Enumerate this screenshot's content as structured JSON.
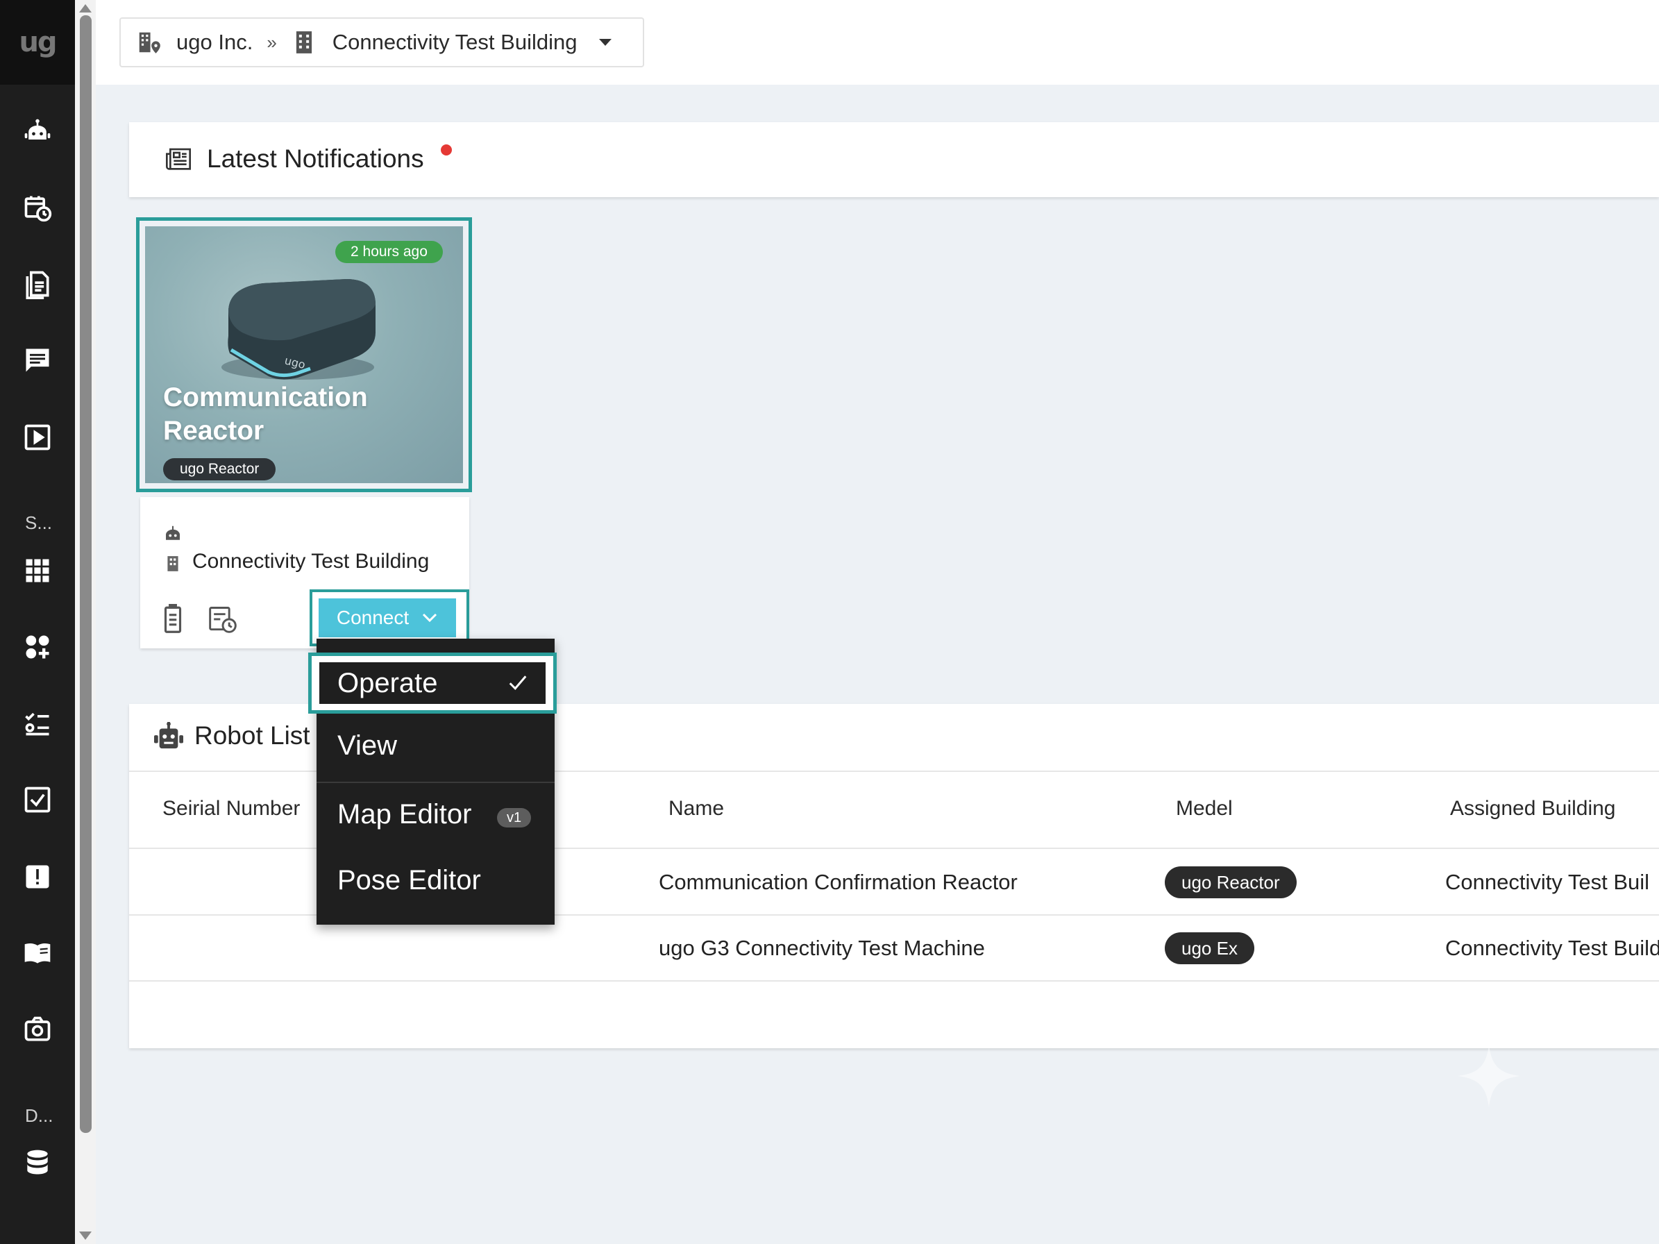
{
  "app": {
    "logo_text": "ug"
  },
  "sidebar": {
    "icons": [
      "robot-icon",
      "calendar-clock-icon",
      "document-icon",
      "chat-icon",
      "play-icon",
      "grid-icon",
      "apps-icon",
      "checklist-icon",
      "checkbox-icon",
      "alert-icon",
      "book-icon",
      "camera-icon",
      "database-icon"
    ],
    "section_labels": [
      "S...",
      "D..."
    ]
  },
  "breadcrumb": {
    "org": "ugo Inc.",
    "separator": "»",
    "building": "Connectivity Test Building"
  },
  "notifications": {
    "title": "Latest Notifications",
    "card": {
      "time": "2 hours ago",
      "title": "Communication Reactor",
      "model": "ugo Reactor",
      "device_label": "ugo",
      "building": "Connectivity Test Building",
      "connect_label": "Connect"
    }
  },
  "connect_menu": {
    "items": [
      "Operate",
      "View",
      "Map Editor",
      "Pose Editor"
    ],
    "selected": "Operate",
    "map_editor_badge": "v1"
  },
  "robot_list": {
    "title": "Robot List",
    "columns": [
      "Seirial Number",
      "Name",
      "Medel",
      "Assigned Building"
    ],
    "rows": [
      {
        "name": "Communication Confirmation Reactor",
        "model": "ugo Reactor",
        "building": "Connectivity Test Buil"
      },
      {
        "name": "ugo G3 Connectivity Test Machine",
        "model": "ugo Ex",
        "building": "Connectivity Test Build"
      }
    ]
  },
  "colors": {
    "sidebar_bg": "#1e1e1e",
    "accent_teal": "#2a9d9a",
    "connect_button": "#4dc3da",
    "time_badge": "#3fa34d",
    "notification_dot": "#e53935"
  }
}
